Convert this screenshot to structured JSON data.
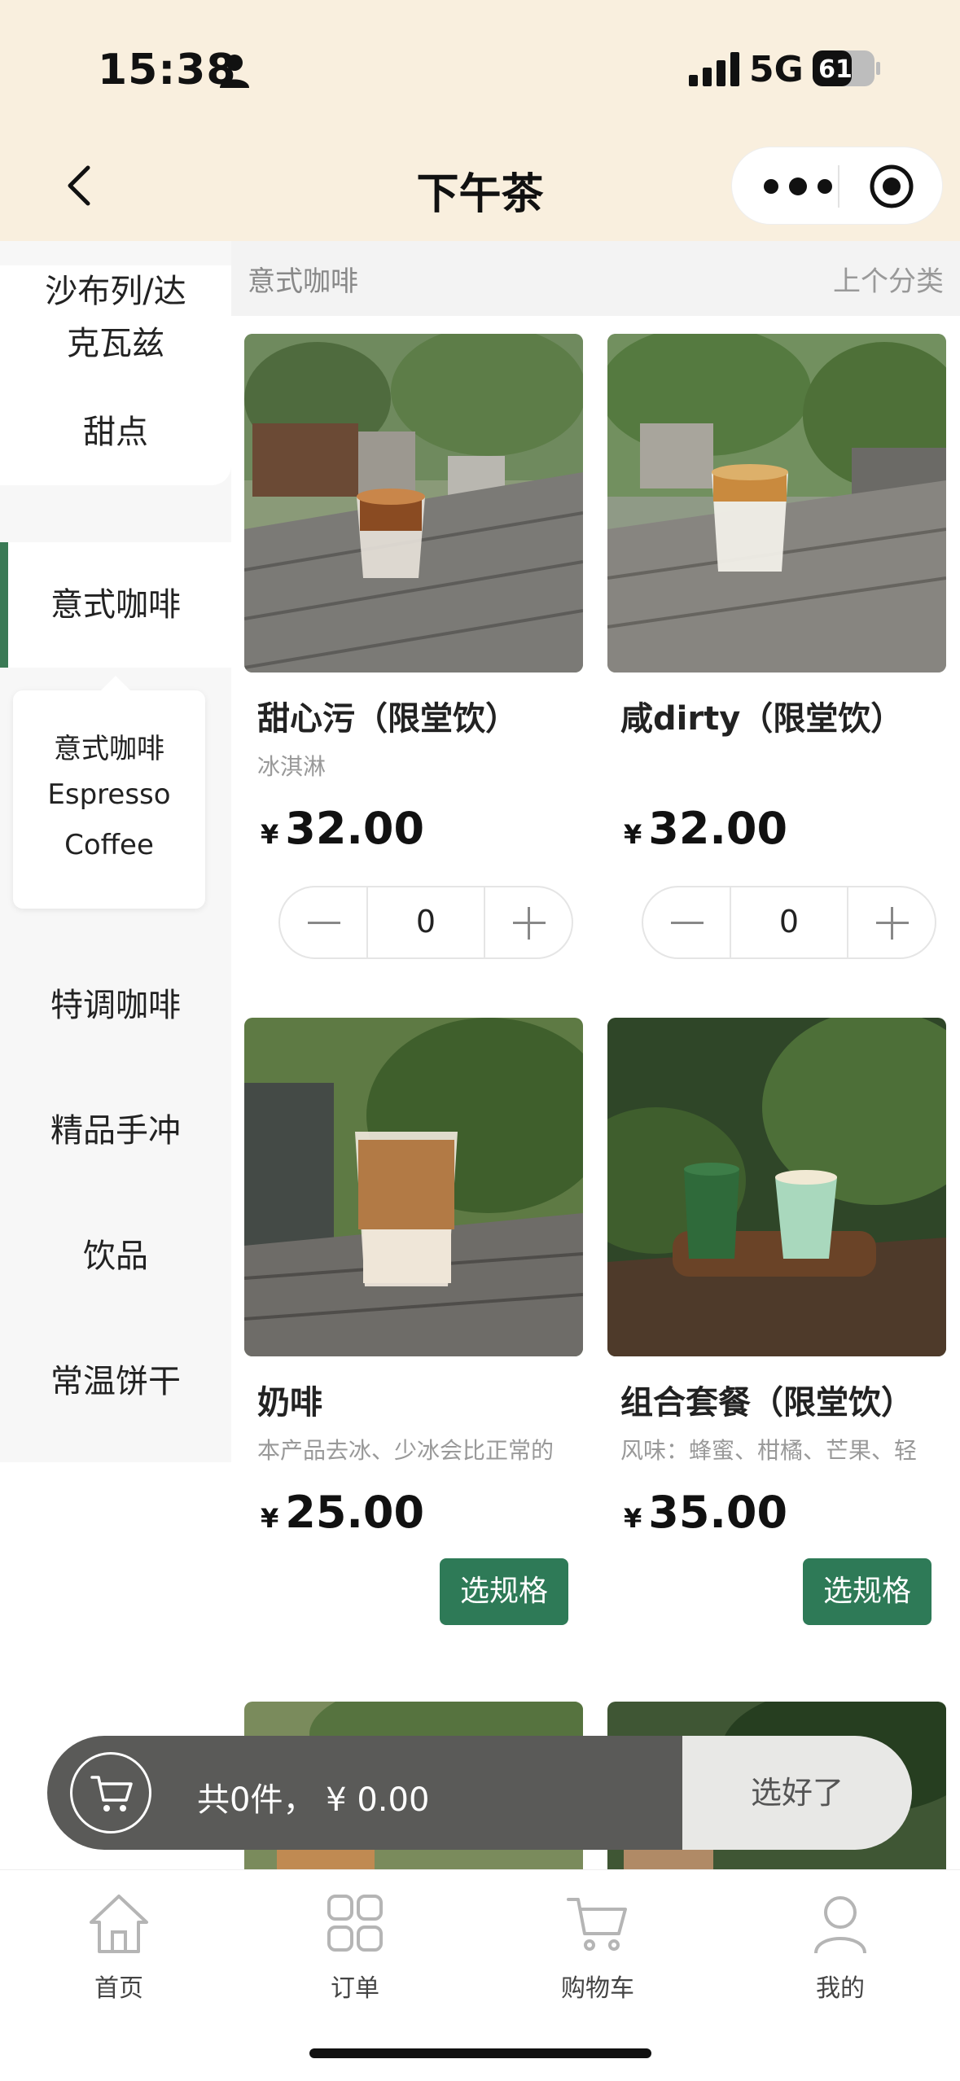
{
  "status_bar": {
    "time": "15:38",
    "network": "5G",
    "battery": "61"
  },
  "nav": {
    "title": "下午茶",
    "back_icon": "chevron-left-icon",
    "more_icon": "more-dots-icon",
    "close_icon": "target-circle-icon"
  },
  "sidebar": {
    "categories": [
      {
        "label_line1": "沙布列/达",
        "label_line2": "克瓦兹"
      },
      {
        "label": "甜点"
      },
      {
        "label": "意式咖啡",
        "active": true
      },
      {
        "label": "特调咖啡"
      },
      {
        "label": "精品手冲"
      },
      {
        "label": "饮品"
      },
      {
        "label": "常温饼干"
      }
    ],
    "subcategory": {
      "line1": "意式咖啡",
      "line2": "Espresso",
      "line3": "Coffee"
    }
  },
  "section": {
    "title": "意式咖啡",
    "prev": "上个分类"
  },
  "products": [
    {
      "name": "甜心污（限堂饮）",
      "desc": "冰淇淋",
      "currency": "¥",
      "price": "32.00",
      "control": "stepper",
      "qty": "0"
    },
    {
      "name": "咸dirty（限堂饮）",
      "desc": "",
      "currency": "¥",
      "price": "32.00",
      "control": "stepper",
      "qty": "0"
    },
    {
      "name": "奶啡",
      "desc": "本产品去冰、少冰会比正常的",
      "currency": "¥",
      "price": "25.00",
      "control": "spec",
      "button": "选规格"
    },
    {
      "name": "组合套餐（限堂饮）",
      "desc": "风味：蜂蜜、柑橘、芒果、轻",
      "currency": "¥",
      "price": "35.00",
      "control": "spec",
      "button": "选规格"
    }
  ],
  "cart": {
    "summary": "共0件，  ¥ 0.00",
    "done": "选好了",
    "icon": "cart-icon"
  },
  "tabbar": [
    {
      "label": "首页",
      "icon": "home-icon"
    },
    {
      "label": "订单",
      "icon": "grid-icon"
    },
    {
      "label": "购物车",
      "icon": "cart-icon"
    },
    {
      "label": "我的",
      "icon": "user-icon"
    }
  ],
  "colors": {
    "header_bg": "#f9efde",
    "accent": "#2e7a57",
    "cart_bar": "#5a5a58"
  }
}
